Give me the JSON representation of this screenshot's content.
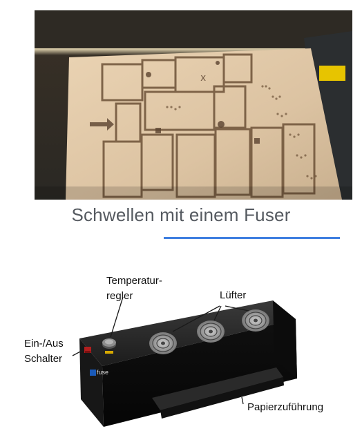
{
  "caption": "Schwellen mit einem Fuser",
  "colors": {
    "accent_line": "#3f7fe0",
    "caption_text": "#555a60"
  },
  "device_labels": {
    "temperature_line1": "Temperatur-",
    "temperature_line2": "regler",
    "fans": "Lüfter",
    "switch_line1": "Ein-/Aus",
    "switch_line2": "Schalter",
    "paper_feed": "Papierzuführung",
    "brand": "fuse"
  }
}
